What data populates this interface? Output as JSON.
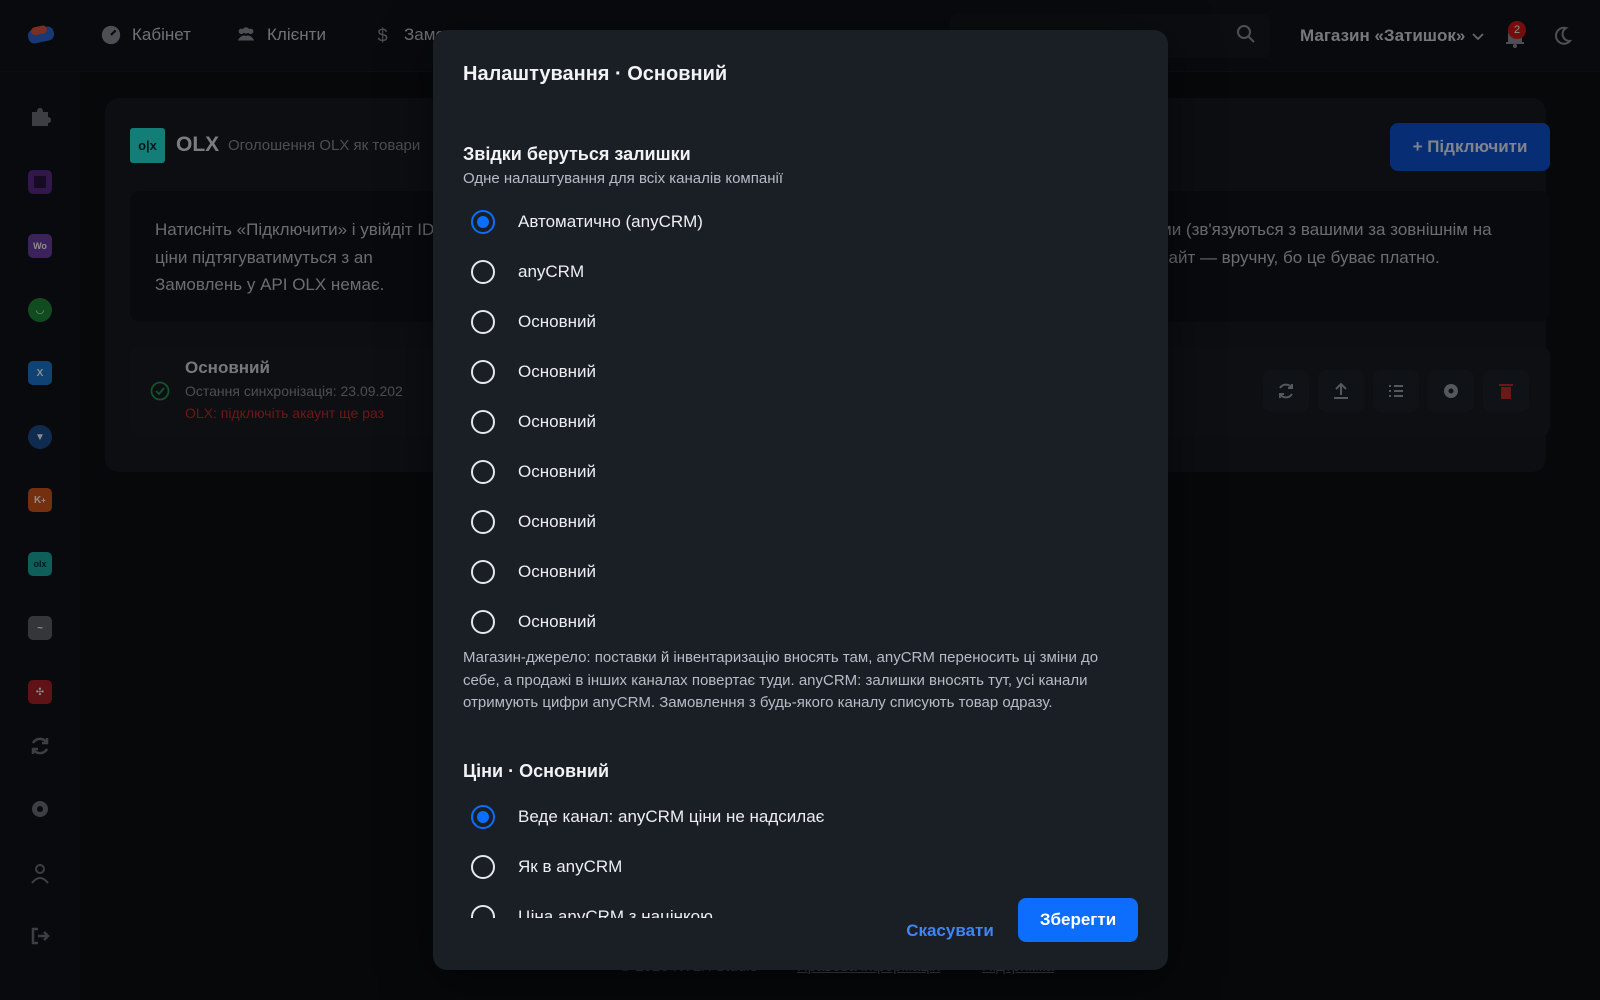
{
  "topbar": {
    "nav": [
      {
        "label": "Кабінет",
        "icon": "dashboard-icon"
      },
      {
        "label": "Клієнти",
        "icon": "users-icon"
      },
      {
        "label": "Замо",
        "icon": "dollar-icon"
      }
    ],
    "store_label": "Магазин «Затишок»",
    "notification_count": "2"
  },
  "page": {
    "title": "OLX",
    "subtitle": "Оголошення OLX як товари",
    "connect_button": "+ Підключити",
    "info_left": "Натисніть «Підключити» і увійдіт ID), ціни підтягуватимуться з an Замовлень у API OLX немає.",
    "info_right": "ми (зв'язуються з вашими за зовнішнім на сайт — вручну, бо це буває платно.",
    "channel": {
      "name": "Основний",
      "sync": "Остання синхронізація: 23.09.202",
      "error": "OLX: підключіть акаунт ще раз"
    },
    "footer": {
      "copyright": "© 2026 KVLK Studio",
      "legal": "Правова інформація",
      "support": "Підтримка"
    }
  },
  "modal": {
    "title": "Налаштування · Основний",
    "stock": {
      "title": "Звідки беруться залишки",
      "subtitle": "Одне налаштування для всіх каналів компанії",
      "options": [
        {
          "label": "Автоматично (anyCRM)",
          "checked": true
        },
        {
          "label": "anyCRM",
          "checked": false
        },
        {
          "label": "Основний",
          "checked": false
        },
        {
          "label": "Основний",
          "checked": false
        },
        {
          "label": "Основний",
          "checked": false
        },
        {
          "label": "Основний",
          "checked": false
        },
        {
          "label": "Основний",
          "checked": false
        },
        {
          "label": "Основний",
          "checked": false
        },
        {
          "label": "Основний",
          "checked": false
        }
      ],
      "description": "Магазин-джерело: поставки й інвентаризацію вносять там, anyCRM переносить ці зміни до себе, а продажі в інших каналах повертає туди. anyCRM: залишки вносять тут, усі канали отримують цифри anyCRM. Замовлення з будь-якого каналу списують товар одразу."
    },
    "prices": {
      "title": "Ціни · Основний",
      "options": [
        {
          "label": "Веде канал: anyCRM ціни не надсилає",
          "checked": true
        },
        {
          "label": "Як в anyCRM",
          "checked": false
        },
        {
          "label": "Ціна anyCRM з націнкою",
          "checked": false
        }
      ]
    },
    "cancel_label": "Скасувати",
    "save_label": "Зберегти"
  },
  "colors": {
    "accent": "#0d6efd",
    "danger": "#d11a1a",
    "olx": "#23e5db"
  }
}
